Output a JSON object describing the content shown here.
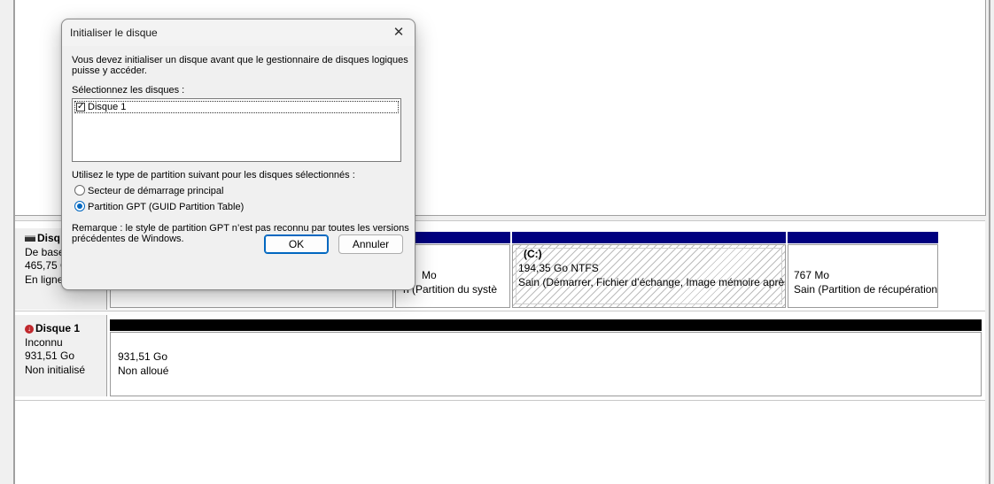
{
  "disks": [
    {
      "name": "Disq",
      "type": "De base",
      "size": "465,75 G",
      "status": "En ligne",
      "partitions": [
        {
          "label": "",
          "size": "",
          "status": ""
        },
        {
          "label": "",
          "size": "Mo",
          "status": "n (Partition du systè"
        },
        {
          "label": "(C:)",
          "size": "194,35 Go NTFS",
          "status": "Sain (Démarrer, Fichier d’échange, Image mémoire après"
        },
        {
          "label": "",
          "size": "767 Mo",
          "status": "Sain (Partition de récupération"
        }
      ]
    },
    {
      "name": "Disque 1",
      "type": "Inconnu",
      "size": "931,51 Go",
      "status": "Non initialisé",
      "partitions": [
        {
          "size": "931,51 Go",
          "status": "Non alloué"
        }
      ]
    }
  ],
  "dialog": {
    "title": "Initialiser le disque",
    "intro_line1": "Vous devez initialiser un disque avant que le gestionnaire de disques logiques",
    "intro_line2": "puisse y accéder.",
    "select_label": "Sélectionnez les disques :",
    "disk_items": [
      {
        "label": "Disque 1",
        "checked": true
      }
    ],
    "partition_style_label": "Utilisez le type de partition suivant pour les disques sélectionnés :",
    "options": [
      {
        "label": "Secteur de démarrage principal",
        "selected": false
      },
      {
        "label": "Partition GPT (GUID Partition Table)",
        "selected": true
      }
    ],
    "note_line1": "Remarque : le style de partition GPT n’est pas reconnu par toutes les versions",
    "note_line2": "précédentes de Windows.",
    "ok_label": "OK",
    "cancel_label": "Annuler"
  },
  "colors": {
    "primary_partition": "#00007f",
    "unallocated": "#000000",
    "accent": "#0067c0"
  }
}
